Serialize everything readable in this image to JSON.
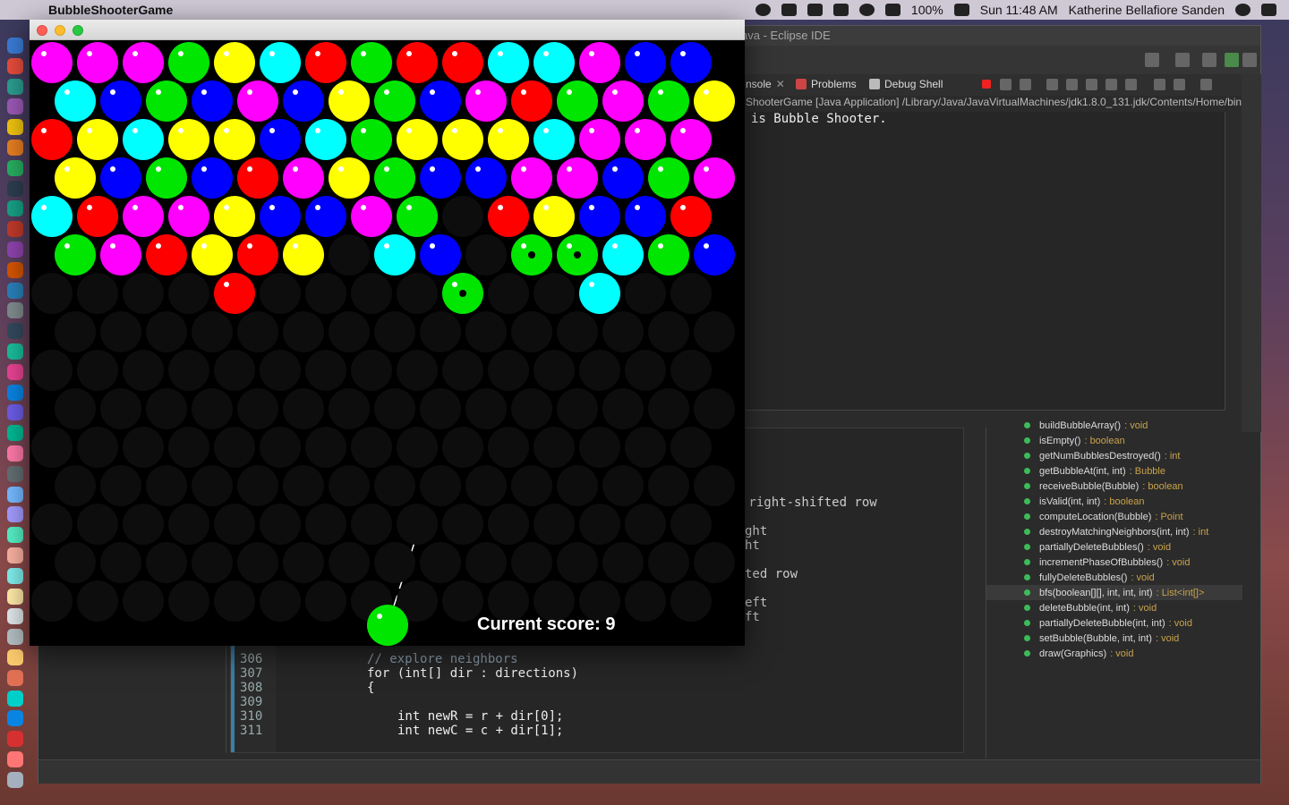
{
  "menubar": {
    "app_name": "BubbleShooterGame",
    "battery": "100%",
    "clock": "Sun 11:48 AM",
    "user": "Katherine Bellafiore Sanden"
  },
  "eclipse": {
    "title": "ava - Eclipse IDE",
    "tabs": [
      {
        "label": "nsole"
      },
      {
        "label": "Problems"
      },
      {
        "label": "Debug Shell"
      }
    ],
    "console_path": "ShooterGame [Java Application] /Library/Java/JavaVirtualMachines/jdk1.8.0_131.jdk/Contents/Home/bin/",
    "console_output": "is Bubble Shooter.",
    "editor_fragments": [
      " right-shifted row",
      "ght",
      "ht",
      "ted row",
      "eft",
      "ft"
    ],
    "code_lines": [
      {
        "num": "306",
        "text": "// explore neighbors"
      },
      {
        "num": "307",
        "text": "for (int[] dir : directions)"
      },
      {
        "num": "308",
        "text": "{"
      },
      {
        "num": "309",
        "text": ""
      },
      {
        "num": "310",
        "text": "int newR = r + dir[0];"
      },
      {
        "num": "311",
        "text": "int newC = c + dir[1];"
      }
    ],
    "outline": [
      {
        "name": "buildBubbleArray()",
        "ret": "void"
      },
      {
        "name": "isEmpty()",
        "ret": "boolean"
      },
      {
        "name": "getNumBubblesDestroyed()",
        "ret": "int"
      },
      {
        "name": "getBubbleAt(int, int)",
        "ret": "Bubble"
      },
      {
        "name": "receiveBubble(Bubble)",
        "ret": "boolean"
      },
      {
        "name": "isValid(int, int)",
        "ret": "boolean"
      },
      {
        "name": "computeLocation(Bubble)",
        "ret": "Point"
      },
      {
        "name": "destroyMatchingNeighbors(int, int)",
        "ret": "int"
      },
      {
        "name": "partiallyDeleteBubbles()",
        "ret": "void"
      },
      {
        "name": "incrementPhaseOfBubbles()",
        "ret": "void"
      },
      {
        "name": "fullyDeleteBubbles()",
        "ret": "void"
      },
      {
        "name": "bfs(boolean[][], int, int, int)",
        "ret": "List<int[]>"
      },
      {
        "name": "deleteBubble(int, int)",
        "ret": "void"
      },
      {
        "name": "partiallyDeleteBubble(int, int)",
        "ret": "void"
      },
      {
        "name": "setBubble(Bubble, int, int)",
        "ret": "void"
      },
      {
        "name": "draw(Graphics)",
        "ret": "void"
      }
    ]
  },
  "game": {
    "window_title": "",
    "score_label": "Current score: 9",
    "colors": {
      "M": "#ff00ff",
      "G": "#00e600",
      "Y": "#ffff00",
      "C": "#00ffff",
      "R": "#ff0000",
      "B": "#0000ff"
    },
    "rows": [
      "MMMGYCRGRRCCMBB",
      "CBGBMBYGBMRGMGY",
      "RYCYYBCGYYYCMMM",
      "YBGBRMYGBBMMBGM",
      "CRMMYBBMG.RYBBR",
      "GMRYRY.CB.GGCGB",
      "....R....G..C.."
    ],
    "center_marked": [
      [
        5,
        10
      ],
      [
        5,
        11
      ],
      [
        6,
        9
      ]
    ],
    "shooter_color": "G",
    "aim_angle_deg": 72
  }
}
